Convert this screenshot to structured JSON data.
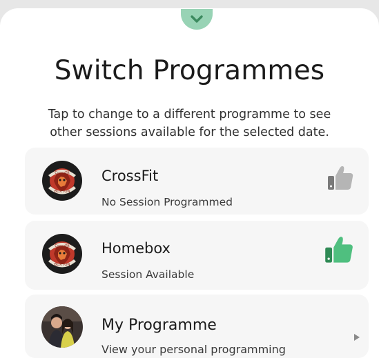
{
  "sheet": {
    "collapse_icon": "chevron-down-icon",
    "title": "Switch Programmes",
    "subtitle_line1": "Tap to change to a different programme to see",
    "subtitle_line2": "other sessions available for the selected date."
  },
  "programmes": [
    {
      "name": "CrossFit",
      "status": "No Session Programmed",
      "logo_text_top": "CrossFit",
      "logo_text_bottom": "BUXTON",
      "indicator_icon": "thumbs-up-icon",
      "indicator_color": "#b5b5b5"
    },
    {
      "name": "Homebox",
      "status": "Session Available",
      "logo_text_top": "CrossFit",
      "logo_text_bottom": "BUXTON",
      "indicator_icon": "thumbs-up-icon",
      "indicator_color": "#4fbf7f"
    },
    {
      "name": "My Programme",
      "status": "View your personal programming",
      "indicator_icon": "chevron-right-icon",
      "indicator_color": "#8a8a8a"
    }
  ],
  "colors": {
    "accent": "#98d3b5",
    "accent_dark": "#3c8a5f",
    "card_bg": "#f6f6f6",
    "logo_red": "#c0392b"
  }
}
